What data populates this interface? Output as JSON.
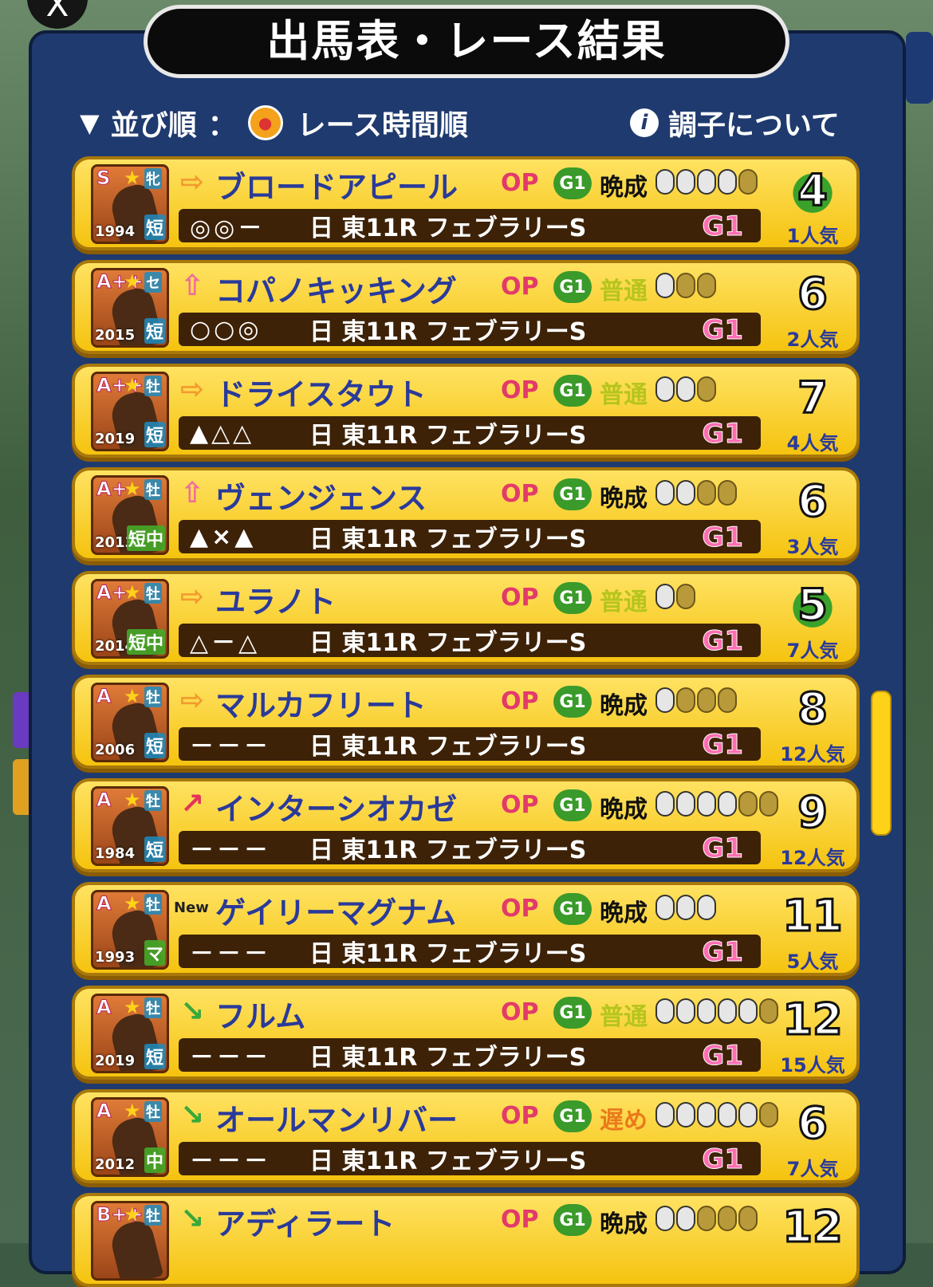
{
  "window": {
    "close_label": "X"
  },
  "header": {
    "title": "出馬表・レース結果"
  },
  "sort": {
    "arrow": "▼",
    "label": "並び順",
    "separator": "：",
    "value": "レース時間順"
  },
  "info": {
    "label": "調子について",
    "icon_glyph": "i"
  },
  "horses": [
    {
      "rank": "S",
      "sex": "牝",
      "year": "1994",
      "dist": "短",
      "arrow": "⇨",
      "arrow_color": "#f29a2e",
      "name": "ブロードアピール",
      "op": "OP",
      "g1": "G1",
      "growth": "晩成",
      "growth_type": "bansei",
      "shoes": [
        1,
        1,
        1,
        1,
        0
      ],
      "marks": "◎◎－",
      "race": "日 東11R フェブラリーS",
      "grade": "G1",
      "number": "4",
      "laurel": true,
      "popularity": "1人気"
    },
    {
      "rank": "A++",
      "sex": "セ",
      "year": "2015",
      "dist": "短",
      "arrow": "⇧",
      "arrow_color": "#f06aa0",
      "name": "コパノキッキング",
      "op": "OP",
      "g1": "G1",
      "growth": "普通",
      "growth_type": "futsu",
      "shoes": [
        1,
        0,
        0
      ],
      "marks": "○○◎",
      "race": "日 東11R フェブラリーS",
      "grade": "G1",
      "number": "6",
      "laurel": false,
      "popularity": "2人気"
    },
    {
      "rank": "A++",
      "sex": "牡",
      "year": "2019",
      "dist": "短",
      "arrow": "⇨",
      "arrow_color": "#f29a2e",
      "name": "ドライスタウト",
      "op": "OP",
      "g1": "G1",
      "growth": "普通",
      "growth_type": "futsu",
      "shoes": [
        1,
        1,
        0
      ],
      "marks": "▲△△",
      "race": "日 東11R フェブラリーS",
      "grade": "G1",
      "number": "7",
      "laurel": false,
      "popularity": "4人気"
    },
    {
      "rank": "A+",
      "sex": "牡",
      "year": "2013",
      "dist": "短中",
      "arrow": "⇧",
      "arrow_color": "#f06aa0",
      "name": "ヴェンジェンス",
      "op": "OP",
      "g1": "G1",
      "growth": "晩成",
      "growth_type": "bansei",
      "shoes": [
        1,
        1,
        0,
        0
      ],
      "marks": "▲×▲",
      "race": "日 東11R フェブラリーS",
      "grade": "G1",
      "number": "6",
      "laurel": false,
      "popularity": "3人気"
    },
    {
      "rank": "A+",
      "sex": "牡",
      "year": "2014",
      "dist": "短中",
      "arrow": "⇨",
      "arrow_color": "#f29a2e",
      "name": "ユラノト",
      "op": "OP",
      "g1": "G1",
      "growth": "普通",
      "growth_type": "futsu",
      "shoes": [
        1,
        0
      ],
      "marks": "△－△",
      "race": "日 東11R フェブラリーS",
      "grade": "G1",
      "number": "5",
      "laurel": true,
      "popularity": "7人気"
    },
    {
      "rank": "A",
      "sex": "牡",
      "year": "2006",
      "dist": "短",
      "arrow": "⇨",
      "arrow_color": "#f29a2e",
      "name": "マルカフリート",
      "op": "OP",
      "g1": "G1",
      "growth": "晩成",
      "growth_type": "bansei",
      "shoes": [
        1,
        0,
        0,
        0
      ],
      "marks": "－－－",
      "race": "日 東11R フェブラリーS",
      "grade": "G1",
      "number": "8",
      "laurel": false,
      "popularity": "12人気"
    },
    {
      "rank": "A",
      "sex": "牡",
      "year": "1984",
      "dist": "短",
      "arrow": "↗",
      "arrow_color": "#e5335a",
      "name": "インターシオカゼ",
      "op": "OP",
      "g1": "G1",
      "growth": "晩成",
      "growth_type": "bansei",
      "shoes": [
        1,
        1,
        1,
        1,
        0,
        0
      ],
      "marks": "－－－",
      "race": "日 東11R フェブラリーS",
      "grade": "G1",
      "number": "9",
      "laurel": false,
      "popularity": "12人気"
    },
    {
      "rank": "A",
      "sex": "牡",
      "year": "1993",
      "dist": "マ",
      "arrow": "New",
      "arrow_color": "#222222",
      "name": "ゲイリーマグナム",
      "op": "OP",
      "g1": "G1",
      "growth": "晩成",
      "growth_type": "bansei",
      "shoes": [
        1,
        1,
        1
      ],
      "marks": "－－－",
      "race": "日 東11R フェブラリーS",
      "grade": "G1",
      "number": "11",
      "laurel": false,
      "popularity": "5人気"
    },
    {
      "rank": "A",
      "sex": "牡",
      "year": "2019",
      "dist": "短",
      "arrow": "↘",
      "arrow_color": "#3aa83a",
      "name": "フルム",
      "op": "OP",
      "g1": "G1",
      "growth": "普通",
      "growth_type": "futsu",
      "shoes": [
        1,
        1,
        1,
        1,
        1,
        0
      ],
      "marks": "－－－",
      "race": "日 東11R フェブラリーS",
      "grade": "G1",
      "number": "12",
      "laurel": false,
      "popularity": "15人気"
    },
    {
      "rank": "A",
      "sex": "牡",
      "year": "2012",
      "dist": "中",
      "arrow": "↘",
      "arrow_color": "#3aa83a",
      "name": "オールマンリバー",
      "op": "OP",
      "g1": "G1",
      "growth": "遅め",
      "growth_type": "osome",
      "shoes": [
        1,
        1,
        1,
        1,
        1,
        0
      ],
      "marks": "－－－",
      "race": "日 東11R フェブラリーS",
      "grade": "G1",
      "number": "6",
      "laurel": false,
      "popularity": "7人気"
    },
    {
      "rank": "B++",
      "sex": "牡",
      "year": "",
      "dist": "",
      "arrow": "↘",
      "arrow_color": "#3aa83a",
      "name": "アディラート",
      "op": "OP",
      "g1": "G1",
      "growth": "晩成",
      "growth_type": "bansei",
      "shoes": [
        1,
        1,
        0,
        0,
        0
      ],
      "marks": "",
      "race": "",
      "grade": "",
      "number": "12",
      "laurel": false,
      "popularity": ""
    }
  ]
}
